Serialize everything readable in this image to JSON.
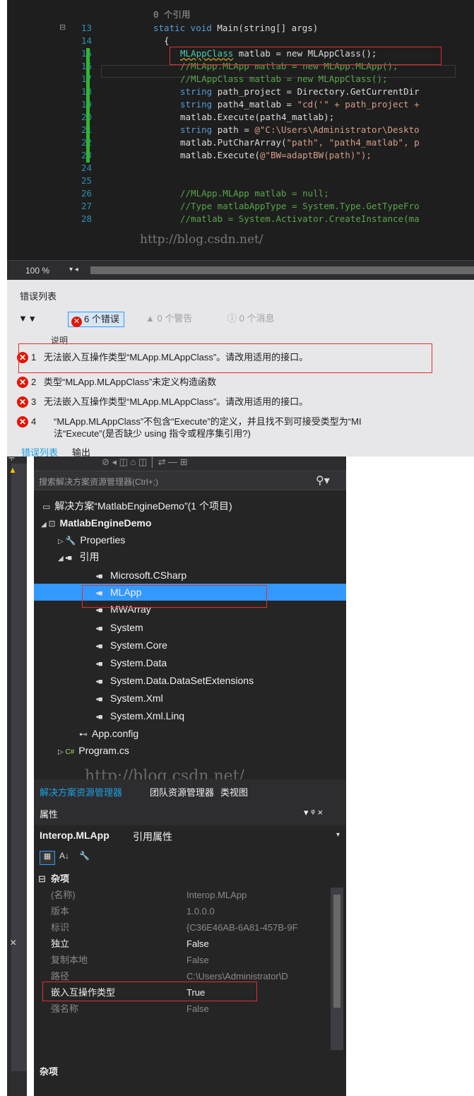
{
  "editor": {
    "ref_hint": "0 个引用",
    "lines": [
      {
        "n": "13",
        "html_key": "l13"
      },
      {
        "n": "14"
      },
      {
        "n": "15"
      },
      {
        "n": "16"
      },
      {
        "n": "17"
      },
      {
        "n": "18"
      },
      {
        "n": "19"
      },
      {
        "n": "20"
      },
      {
        "n": "21"
      },
      {
        "n": "22"
      },
      {
        "n": "23"
      },
      {
        "n": "24"
      },
      {
        "n": "25"
      },
      {
        "n": "26"
      },
      {
        "n": "27"
      },
      {
        "n": "28"
      }
    ],
    "code": {
      "l13_kw": "static void ",
      "l13_rest": "Main(string[] args)",
      "l14": "{",
      "l15_type": "MLAppClass",
      "l15_rest": " matlab = new MLAppClass();",
      "l16": "//MLApp.MLApp matlab = new MLApp.MLApp();",
      "l17": "//MLAppClass matlab = new MLAppClass();",
      "l18_kw": "string ",
      "l18_rest": "path_project = Directory.GetCurrentDir",
      "l19_kw": "string ",
      "l19_rest": "path4_matlab = ",
      "l19_str": "\"cd('\" + path_project +",
      "l20": "matlab.Execute(path4_matlab);",
      "l21_kw": "string ",
      "l21_rest": "path = ",
      "l21_str": "@\"C:\\Users\\Administrator\\Deskto",
      "l22_a": "matlab.PutCharArray(",
      "l22_str": "\"path\", \"path4_matlab\", p",
      "l23_a": "matlab.Execute(",
      "l23_str": "@\"BW=adaptBW(path)\");",
      "l26": "//MLApp.MLApp matlab = null;",
      "l27": "//Type matlabAppType = System.Type.GetTypeFro",
      "l28": "//matlab = System.Activator.CreateInstance(ma"
    },
    "watermark": "http://blog.csdn.net/",
    "zoom": "100 %"
  },
  "errors": {
    "title": "错误列表",
    "filter_errors": "6 个错误",
    "filter_warnings": "0 个警告",
    "filter_messages": "0 个消息",
    "column_desc": "说明",
    "items": [
      {
        "num": "1",
        "text": "无法嵌入互操作类型“MLApp.MLAppClass”。请改用适用的接口。"
      },
      {
        "num": "2",
        "text": "类型“MLApp.MLAppClass”未定义构造函数"
      },
      {
        "num": "3",
        "text": "无法嵌入互操作类型“MLApp.MLAppClass”。请改用适用的接口。"
      },
      {
        "num": "4",
        "text": "“MLApp.MLAppClass”不包含“Execute”的定义，并且找不到可接受类型为“MI"
      },
      {
        "num": "",
        "text": "法“Execute”(是否缺少 using 指令或程序集引用?)"
      }
    ],
    "tab_errors": "错误列表",
    "tab_output": "输出"
  },
  "solution": {
    "search_placeholder": "搜索解决方案资源管理器(Ctrl+;)",
    "root": "解决方案“MatlabEngineDemo”(1 个项目)",
    "project": "MatlabEngineDemo",
    "properties": "Properties",
    "references": "引用",
    "refs": [
      "Microsoft.CSharp",
      "MLApp",
      "MWArray",
      "System",
      "System.Core",
      "System.Data",
      "System.Data.DataSetExtensions",
      "System.Xml",
      "System.Xml.Linq"
    ],
    "appconfig": "App.config",
    "program": "Program.cs",
    "watermark": "http://blog.csdn.net/",
    "tab_solution": "解决方案资源管理器",
    "tab_team": "团队资源管理器",
    "tab_class": "类视图"
  },
  "properties": {
    "title": "属性",
    "controls": "▾ ᵠ ×",
    "object": "Interop.MLApp",
    "object_sub": "引用属性",
    "category": "杂项",
    "rows": [
      {
        "name": "(名称)",
        "value": "Interop.MLApp",
        "dim": true
      },
      {
        "name": "版本",
        "value": "1.0.0.0",
        "dim": true
      },
      {
        "name": "标识",
        "value": "{C36E46AB-6A81-457B-9F",
        "dim": true
      },
      {
        "name": "独立",
        "value": "False",
        "dim": false
      },
      {
        "name": "复制本地",
        "value": "False",
        "dim": true
      },
      {
        "name": "路径",
        "value": "C:\\Users\\Administrator\\D",
        "dim": true
      },
      {
        "name": "嵌入互操作类型",
        "value": "True",
        "dim": false
      },
      {
        "name": "强名称",
        "value": "False",
        "dim": true
      }
    ],
    "footer": "杂项"
  },
  "colors": {
    "error_red": "#e51400",
    "accent_blue": "#3399ff",
    "callout_red": "#e0302c"
  }
}
